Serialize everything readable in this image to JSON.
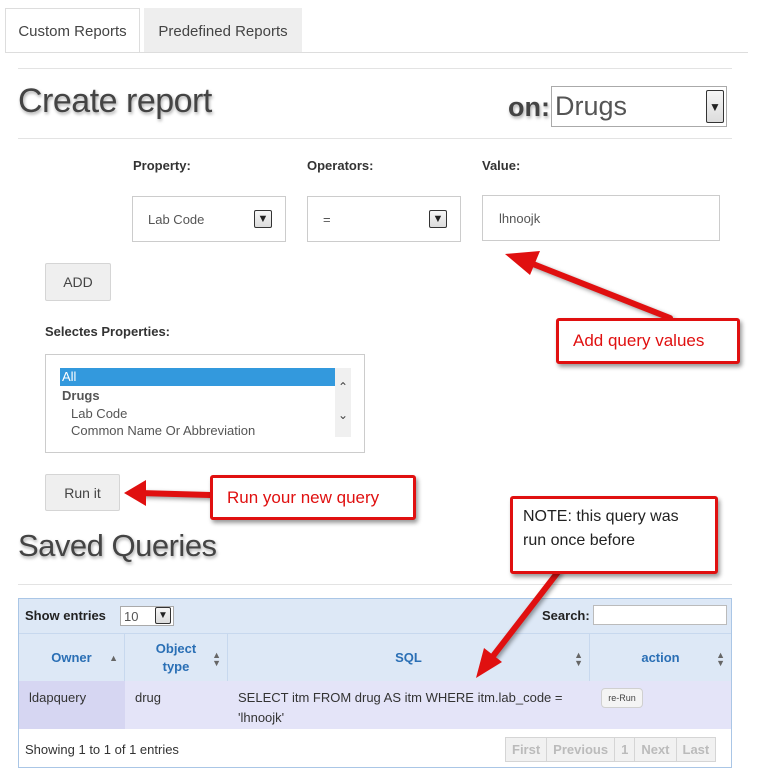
{
  "tabs": [
    "Custom Reports",
    "Predefined Reports"
  ],
  "create_report": {
    "title": "Create report",
    "on_label": "on:",
    "entity": "Drugs",
    "property_label": "Property:",
    "operators_label": "Operators:",
    "value_label": "Value:",
    "property_value": "Lab Code",
    "operator_value": "=",
    "value_input": "lhnoojk",
    "add_label": "ADD",
    "selected_label": "Selectes Properties:",
    "selected_options": [
      "All",
      "Drugs",
      "Lab Code",
      "Common Name Or Abbreviation"
    ],
    "run_label": "Run it"
  },
  "saved_queries": {
    "title": "Saved Queries",
    "show_entries_label": "Show entries",
    "page_size": "10",
    "search_label": "Search:",
    "columns": [
      "Owner",
      "Object type",
      "SQL",
      "action"
    ],
    "rows": [
      {
        "owner": "ldapquery",
        "object_type": "drug",
        "sql": "SELECT itm FROM drug AS itm WHERE itm.lab_code = 'lhnoojk'",
        "action": "re-Run"
      }
    ],
    "info": "Showing 1 to 1 of 1 entries",
    "pager": [
      "First",
      "Previous",
      "1",
      "Next",
      "Last"
    ]
  },
  "annotations": {
    "add_query_values": "Add query values",
    "run_new_query": "Run your new query",
    "note": "NOTE: this query was run once before"
  },
  "colors": {
    "callout_red": "#e01010",
    "table_header": "#dde8f6",
    "selected_option": "#3399dd"
  }
}
